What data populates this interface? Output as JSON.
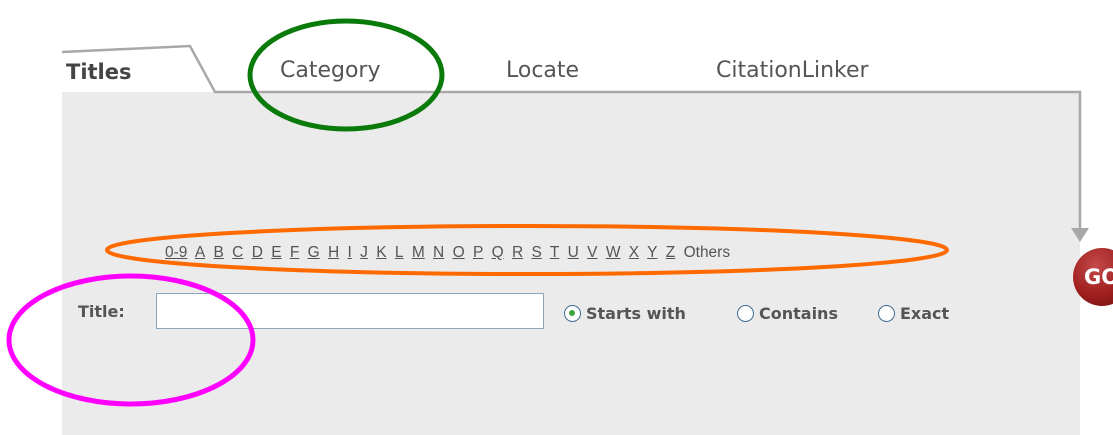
{
  "tabs": [
    {
      "label": "Titles",
      "active": true
    },
    {
      "label": "Category",
      "active": false
    },
    {
      "label": "Locate",
      "active": false
    },
    {
      "label": "CitationLinker",
      "active": false
    }
  ],
  "alphabet": [
    "0-9",
    "A",
    "B",
    "C",
    "D",
    "E",
    "F",
    "G",
    "H",
    "I",
    "J",
    "K",
    "L",
    "M",
    "N",
    "O",
    "P",
    "Q",
    "R",
    "S",
    "T",
    "U",
    "V",
    "W",
    "X",
    "Y",
    "Z"
  ],
  "alphabet_others": "Others",
  "search": {
    "label": "Title:",
    "value": "",
    "placeholder": ""
  },
  "match_options": [
    {
      "label": "Starts with",
      "selected": true
    },
    {
      "label": "Contains",
      "selected": false
    },
    {
      "label": "Exact",
      "selected": false
    }
  ],
  "go_label": "GO",
  "colors": {
    "panel": "#ebebeb",
    "go_button": "#a01f1f",
    "highlight_category": "#0a7a0a",
    "highlight_alphabet": "#ff6a00",
    "highlight_title": "#ff00ff"
  }
}
